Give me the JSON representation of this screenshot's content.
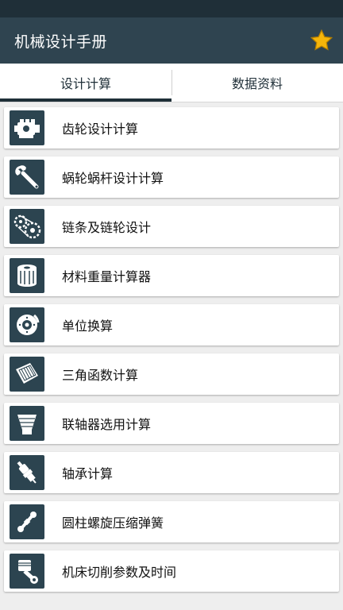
{
  "app": {
    "title": "机械设计手册",
    "favorite_icon": "star-icon",
    "accent_color": "#2f4450",
    "star_color": "#f5b50a"
  },
  "tabs": [
    {
      "label": "设计计算",
      "active": true
    },
    {
      "label": "数据资料",
      "active": false
    }
  ],
  "items": [
    {
      "label": "齿轮设计计算",
      "icon": "engine-icon"
    },
    {
      "label": "蜗轮蜗杆设计计算",
      "icon": "wrench-icon"
    },
    {
      "label": "链条及链轮设计",
      "icon": "chain-sprocket-icon"
    },
    {
      "label": "材料重量计算器",
      "icon": "oil-filter-icon"
    },
    {
      "label": "单位换算",
      "icon": "brake-disc-icon"
    },
    {
      "label": "三角函数计算",
      "icon": "air-filter-icon"
    },
    {
      "label": "联轴器选用计算",
      "icon": "cone-filter-icon"
    },
    {
      "label": "轴承计算",
      "icon": "spark-plug-icon"
    },
    {
      "label": "圆柱螺旋压缩弹簧",
      "icon": "drive-shaft-icon"
    },
    {
      "label": "机床切削参数及时间",
      "icon": "piston-icon"
    }
  ]
}
